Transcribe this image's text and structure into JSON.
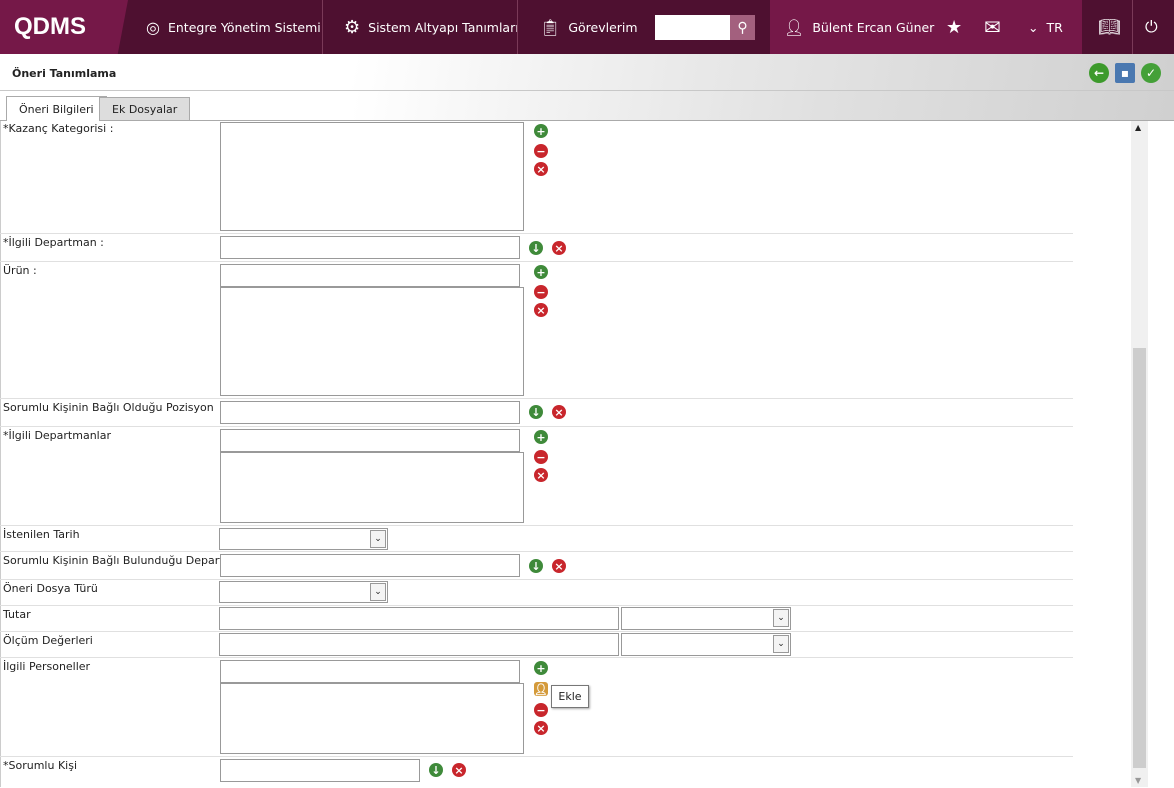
{
  "header": {
    "logo": "QDMS",
    "nav": [
      "Entegre Yönetim Sistemi",
      "Sistem Altyapı Tanımları",
      "Görevlerim"
    ],
    "user": "Bülent Ercan Güner",
    "language": "TR",
    "search_value": ""
  },
  "page": {
    "title": "Öneri Tanımlama",
    "tabs": [
      "Öneri Bilgileri",
      "Ek Dosyalar"
    ]
  },
  "form": {
    "kazanc": "*Kazanç Kategorisi :",
    "ilgili_departman": "*İlgili Departman :",
    "urun": "Ürün :",
    "pozisyon": "Sorumlu Kişinin Bağlı Olduğu Pozisyon",
    "departmanlar": "*İlgili Departmanlar",
    "tarih": "İstenilen Tarih",
    "bagli_departman": "Sorumlu Kişinin Bağlı Bulunduğu Departman",
    "dosya_turu": "Öneri Dosya Türü",
    "tutar": "Tutar",
    "olcum": "Ölçüm Değerleri",
    "personeller": "İlgili Personeller",
    "sorumlu": "*Sorumlu Kişi"
  },
  "tooltip": "Ekle",
  "colors": {
    "header_dark": "#4e1030",
    "header_accent": "#751848"
  }
}
